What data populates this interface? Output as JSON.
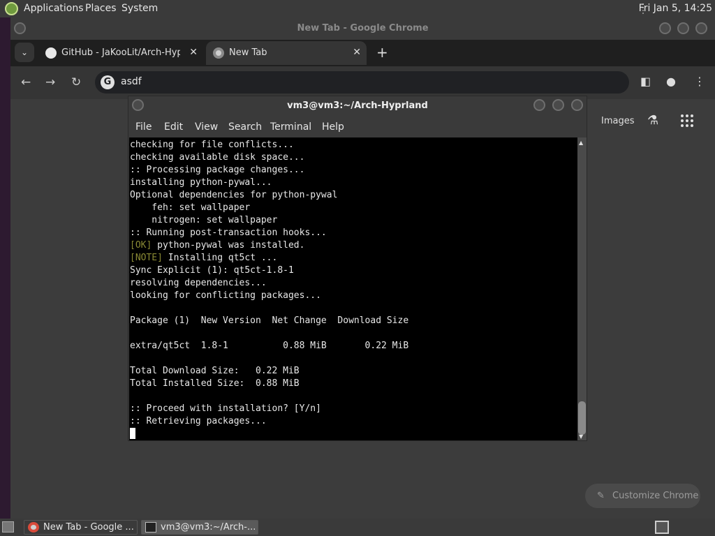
{
  "top_panel": {
    "menu": [
      "Applications",
      "Places",
      "System"
    ],
    "clock": "Fri Jan  5, 14:25"
  },
  "chrome": {
    "title": "New Tab - Google Chrome",
    "tabs": [
      {
        "label": "GitHub - JaKooLit/Arch-Hyprl",
        "active": false,
        "icon": "github-icon"
      },
      {
        "label": "New Tab",
        "active": true,
        "icon": "chrome-icon"
      }
    ],
    "omnibox_value": "asdf",
    "ntp": {
      "images_link": "Images",
      "customize_label": "Customize Chrome"
    }
  },
  "terminal": {
    "title": "vm3@vm3:~/Arch-Hyprland",
    "menu": [
      "File",
      "Edit",
      "View",
      "Search",
      "Terminal",
      "Help"
    ],
    "lines": [
      {
        "text": "checking for file conflicts..."
      },
      {
        "text": "checking available disk space..."
      },
      {
        "text": ":: Processing package changes..."
      },
      {
        "text": "installing python-pywal..."
      },
      {
        "text": "Optional dependencies for python-pywal"
      },
      {
        "text": "    feh: set wallpaper"
      },
      {
        "text": "    nitrogen: set wallpaper"
      },
      {
        "text": ":: Running post-transaction hooks..."
      },
      {
        "tag": "[OK]",
        "text": " python-pywal was installed."
      },
      {
        "tag": "[NOTE]",
        "text": " Installing qt5ct ..."
      },
      {
        "text": "Sync Explicit (1): qt5ct-1.8-1"
      },
      {
        "text": "resolving dependencies..."
      },
      {
        "text": "looking for conflicting packages..."
      },
      {
        "text": ""
      },
      {
        "text": "Package (1)  New Version  Net Change  Download Size"
      },
      {
        "text": ""
      },
      {
        "text": "extra/qt5ct  1.8-1          0.88 MiB       0.22 MiB"
      },
      {
        "text": ""
      },
      {
        "text": "Total Download Size:   0.22 MiB"
      },
      {
        "text": "Total Installed Size:  0.88 MiB"
      },
      {
        "text": ""
      },
      {
        "text": ":: Proceed with installation? [Y/n]"
      },
      {
        "text": ":: Retrieving packages..."
      }
    ],
    "tag_color": "#8a8a34"
  },
  "taskbar": {
    "tasks": [
      {
        "label": "New Tab - Google ...",
        "icon": "chrome-icon",
        "active": false
      },
      {
        "label": "vm3@vm3:~/Arch-...",
        "icon": "terminal-icon",
        "active": true
      }
    ]
  }
}
